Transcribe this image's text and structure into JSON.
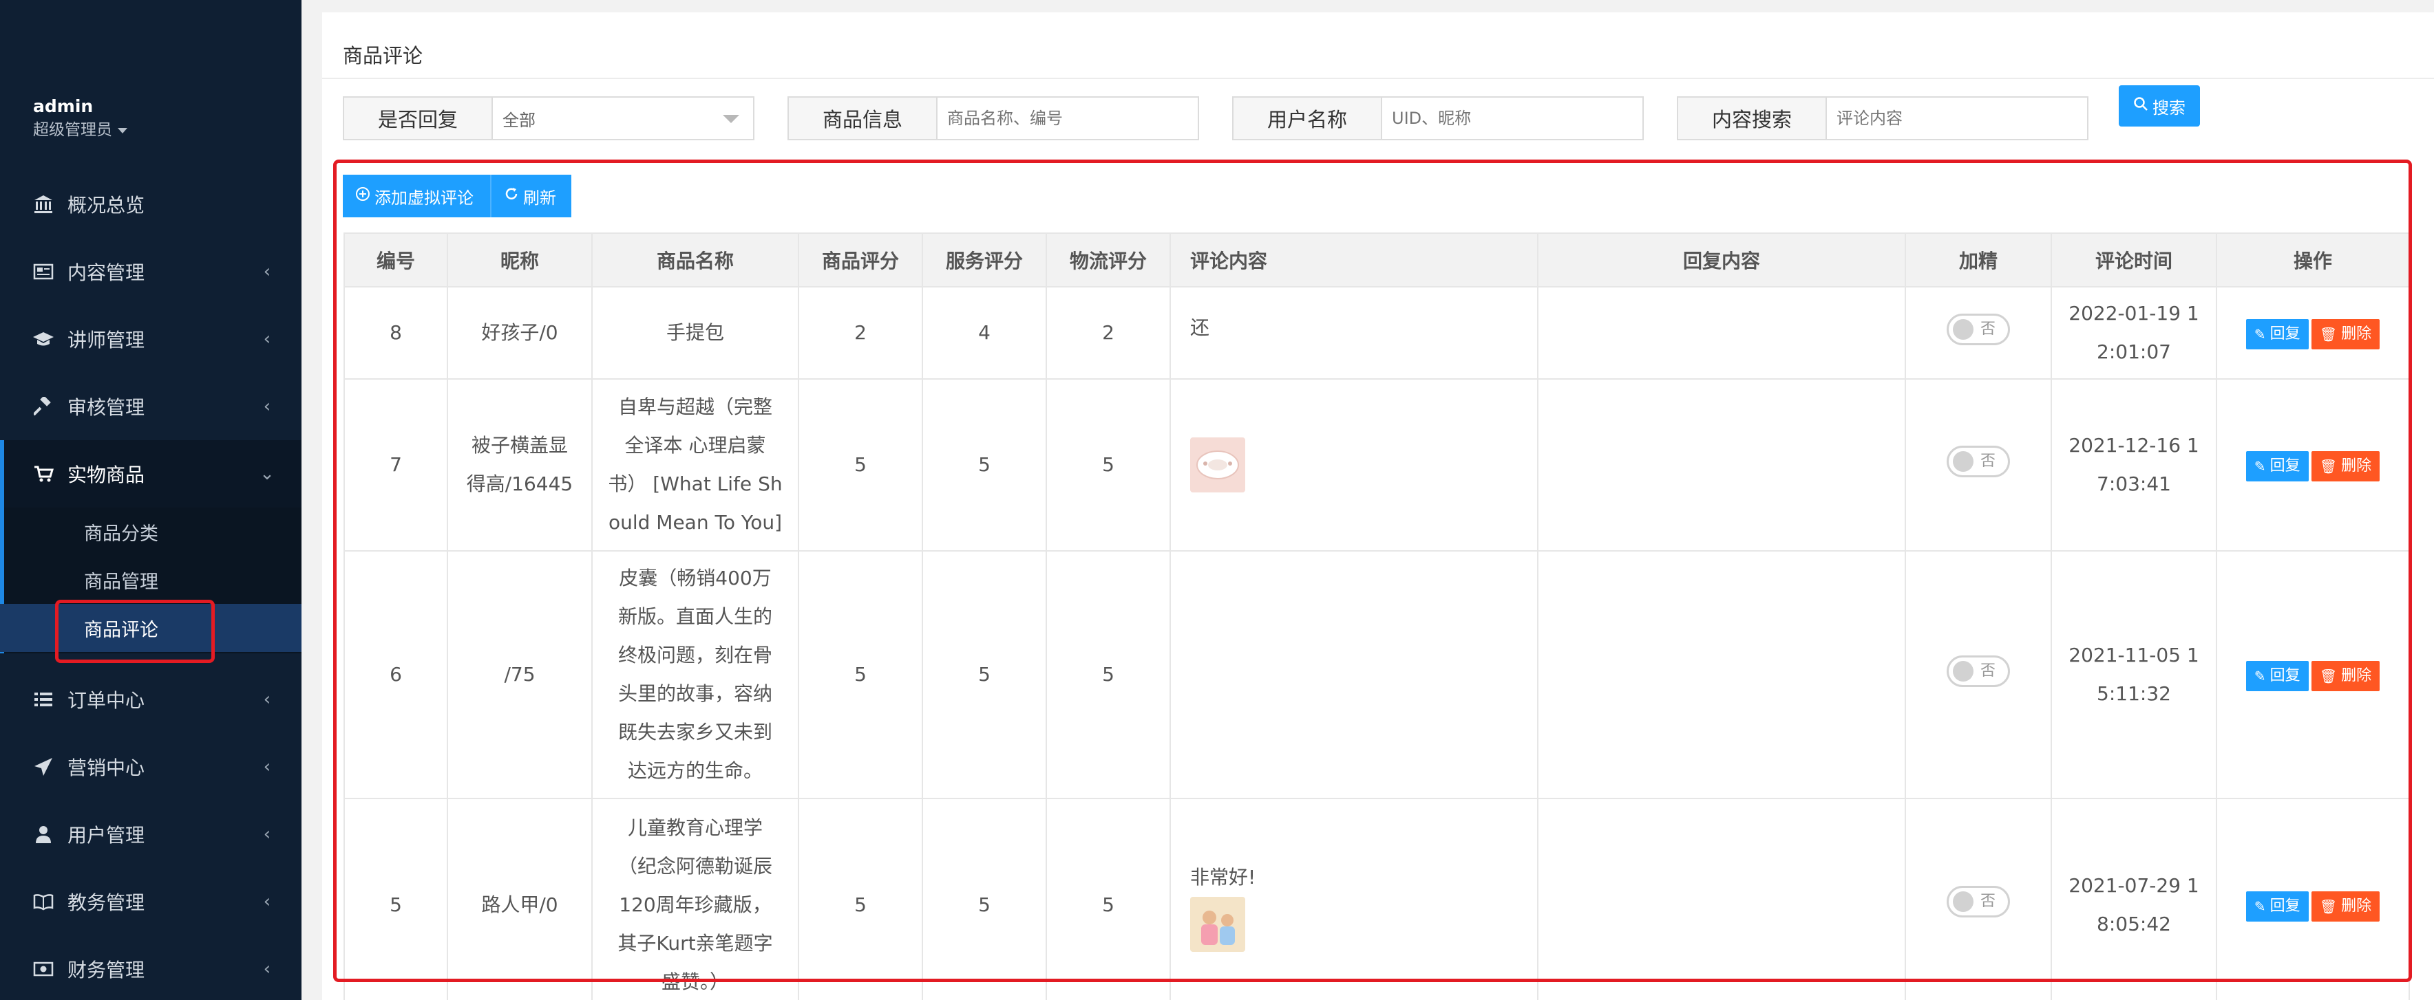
{
  "sidebar": {
    "user": {
      "name": "admin",
      "role": "超级管理员"
    },
    "items": [
      {
        "label": "概况总览",
        "icon": "bank-icon",
        "has_chevron": false
      },
      {
        "label": "内容管理",
        "icon": "newspaper-icon",
        "has_chevron": true
      },
      {
        "label": "讲师管理",
        "icon": "graduation-cap-icon",
        "has_chevron": true
      },
      {
        "label": "审核管理",
        "icon": "gavel-icon",
        "has_chevron": true
      },
      {
        "label": "实物商品",
        "icon": "cart-icon",
        "has_chevron": true,
        "expanded": true
      },
      {
        "label": "订单中心",
        "icon": "list-icon",
        "has_chevron": true
      },
      {
        "label": "营销中心",
        "icon": "paper-plane-icon",
        "has_chevron": true
      },
      {
        "label": "用户管理",
        "icon": "user-icon",
        "has_chevron": true
      },
      {
        "label": "教务管理",
        "icon": "book-icon",
        "has_chevron": true
      },
      {
        "label": "财务管理",
        "icon": "money-icon",
        "has_chevron": true
      }
    ],
    "sub_items": [
      {
        "label": "商品分类"
      },
      {
        "label": "商品管理"
      },
      {
        "label": "商品评论",
        "current": true
      }
    ]
  },
  "page": {
    "title": "商品评论"
  },
  "filters": {
    "reply": {
      "label": "是否回复",
      "value": "全部"
    },
    "product": {
      "label": "商品信息",
      "placeholder": "商品名称、编号"
    },
    "user": {
      "label": "用户名称",
      "placeholder": "UID、昵称"
    },
    "content": {
      "label": "内容搜索",
      "placeholder": "评论内容"
    },
    "search_label": "搜索"
  },
  "toolbar": {
    "add_label": "添加虚拟评论",
    "refresh_label": "刷新"
  },
  "table": {
    "headers": [
      "编号",
      "昵称",
      "商品名称",
      "商品评分",
      "服务评分",
      "物流评分",
      "评论内容",
      "回复内容",
      "加精",
      "评论时间",
      "操作"
    ],
    "rows": [
      {
        "id": "8",
        "nickname": "好孩子/0",
        "product_lines": [
          "手提包"
        ],
        "goods": "2",
        "service": "4",
        "logistics": "2",
        "comment": "还",
        "image": null,
        "reply": "",
        "featured": "否",
        "time_lines": [
          "2022-01-19 1",
          "2:01:07"
        ]
      },
      {
        "id": "7",
        "nickname_lines": [
          "被子横盖显",
          "得高/16445"
        ],
        "product_lines": [
          "自卑与超越（完整",
          "全译本 心理启蒙",
          "书） [What Life Sh",
          "ould Mean To You]"
        ],
        "goods": "5",
        "service": "5",
        "logistics": "5",
        "comment": "",
        "image": "tray",
        "reply": "",
        "featured": "否",
        "time_lines": [
          "2021-12-16 1",
          "7:03:41"
        ]
      },
      {
        "id": "6",
        "nickname": "/75",
        "product_lines": [
          "皮囊（畅销400万",
          "新版。直面人生的",
          "终极问题，刻在骨",
          "头里的故事，容纳",
          "既失去家乡又未到",
          "达远方的生命。"
        ],
        "goods": "5",
        "service": "5",
        "logistics": "5",
        "comment": "",
        "image": null,
        "reply": "",
        "featured": "否",
        "time_lines": [
          "2021-11-05 1",
          "5:11:32"
        ]
      },
      {
        "id": "5",
        "nickname": "路人甲/0",
        "product_lines": [
          "儿童教育心理学",
          "（纪念阿德勒诞辰",
          "120周年珍藏版，",
          "其子Kurt亲笔题字",
          "盛赞。）"
        ],
        "goods": "5",
        "service": "5",
        "logistics": "5",
        "comment": "非常好!",
        "image": "kids",
        "reply": "",
        "featured": "否",
        "time_lines": [
          "2021-07-29 1",
          "8:05:42"
        ]
      }
    ],
    "actions": {
      "reply": "回复",
      "delete": "删除"
    }
  }
}
